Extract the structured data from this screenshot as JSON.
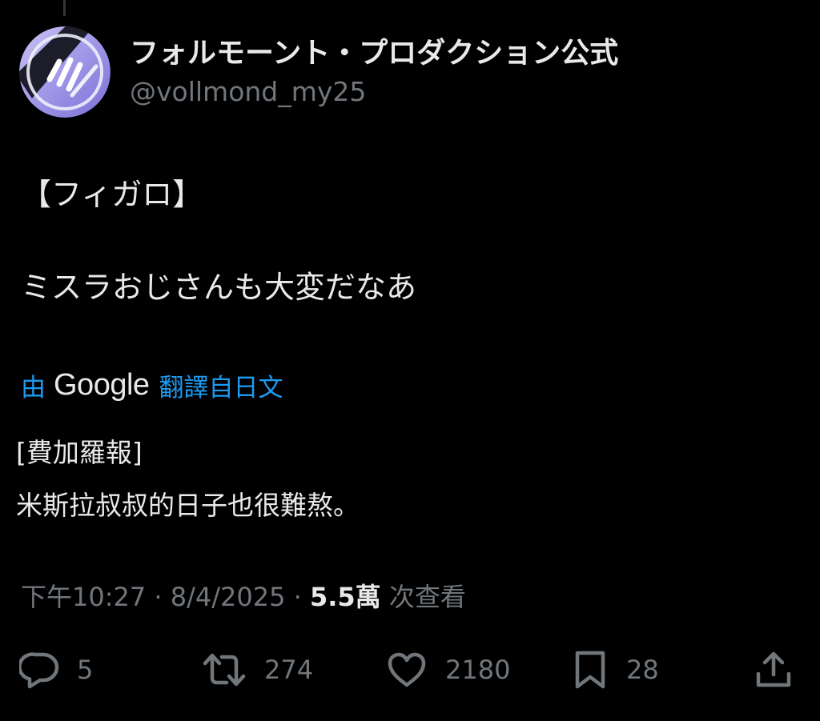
{
  "author": {
    "display_name": "フォルモーント・プロダクション公式",
    "handle": "@vollmond_my25"
  },
  "post": {
    "lines": [
      "【フィガロ】",
      "ミスラおじさんも大変だなあ"
    ]
  },
  "translation": {
    "prefix": "由",
    "provider": "Google",
    "suffix": "翻譯自日文",
    "lines": [
      "[費加羅報]",
      "米斯拉叔叔的日子也很難熬。"
    ]
  },
  "meta": {
    "time": "下午10:27",
    "separator": "·",
    "date": "8/4/2025",
    "views_count": "5.5萬",
    "views_label": "次查看"
  },
  "actions": {
    "reply_count": "5",
    "retweet_count": "274",
    "like_count": "2180",
    "bookmark_count": "28"
  },
  "icons": {
    "reply": "speech-bubble-icon",
    "retweet": "retweet-icon",
    "like": "heart-icon",
    "bookmark": "bookmark-icon",
    "share": "share-upload-icon"
  },
  "colors": {
    "background": "#000000",
    "text_primary": "#e7e9ea",
    "text_secondary": "#71767b",
    "link_blue": "#1d9bf0",
    "avatar_lavender": "#9d93e6"
  }
}
